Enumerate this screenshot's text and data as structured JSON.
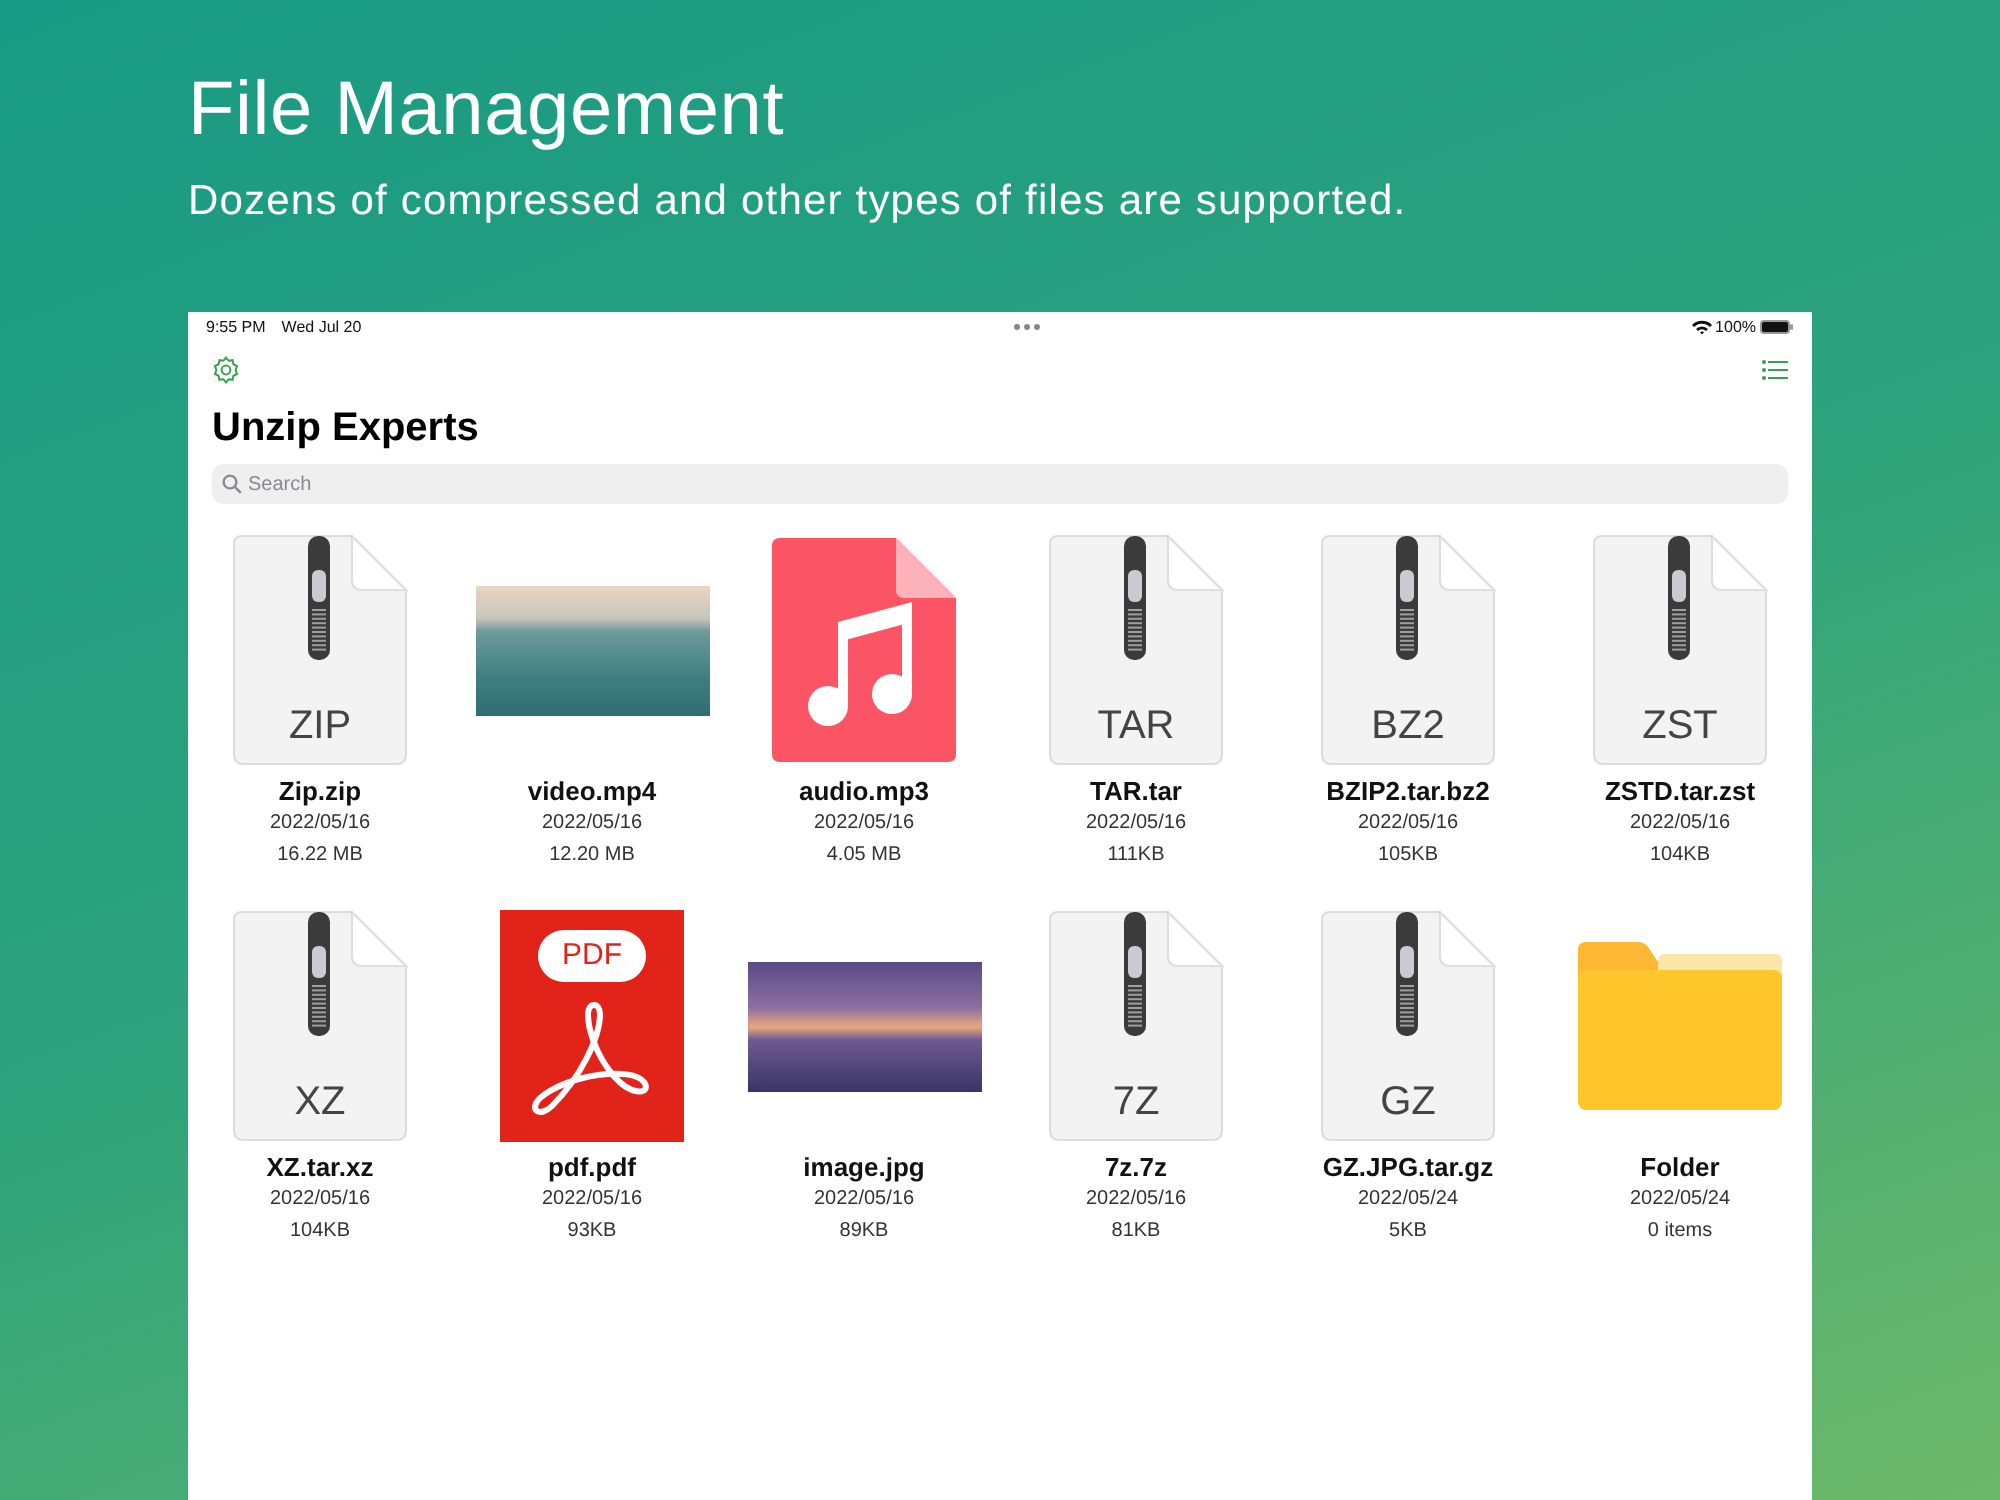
{
  "heading": "File Management",
  "subtitle": "Dozens of compressed and other types of files are supported.",
  "status_bar": {
    "time": "9:55 PM",
    "date": "Wed Jul 20",
    "battery": "100%"
  },
  "app": {
    "title": "Unzip Experts",
    "search": {
      "placeholder": "Search"
    }
  },
  "files": [
    {
      "kind": "archive",
      "type_label": "ZIP",
      "name": "Zip.zip",
      "date": "2022/05/16",
      "size": "16.22 MB"
    },
    {
      "kind": "video",
      "name": "video.mp4",
      "date": "2022/05/16",
      "size": "12.20 MB"
    },
    {
      "kind": "audio",
      "name": "audio.mp3",
      "date": "2022/05/16",
      "size": "4.05 MB"
    },
    {
      "kind": "archive",
      "type_label": "TAR",
      "name": "TAR.tar",
      "date": "2022/05/16",
      "size": "111KB"
    },
    {
      "kind": "archive",
      "type_label": "BZ2",
      "name": "BZIP2.tar.bz2",
      "date": "2022/05/16",
      "size": "105KB"
    },
    {
      "kind": "archive",
      "type_label": "ZST",
      "name": "ZSTD.tar.zst",
      "date": "2022/05/16",
      "size": "104KB"
    },
    {
      "kind": "archive",
      "type_label": "XZ",
      "name": "XZ.tar.xz",
      "date": "2022/05/16",
      "size": "104KB"
    },
    {
      "kind": "pdf",
      "type_label": "PDF",
      "name": "pdf.pdf",
      "date": "2022/05/16",
      "size": "93KB"
    },
    {
      "kind": "image",
      "name": "image.jpg",
      "date": "2022/05/16",
      "size": "89KB"
    },
    {
      "kind": "archive",
      "type_label": "7Z",
      "name": "7z.7z",
      "date": "2022/05/16",
      "size": "81KB"
    },
    {
      "kind": "archive",
      "type_label": "GZ",
      "name": "GZ.JPG.tar.gz",
      "date": "2022/05/24",
      "size": "5KB"
    },
    {
      "kind": "folder",
      "name": "Folder",
      "date": "2022/05/24",
      "size": "0 items"
    }
  ]
}
